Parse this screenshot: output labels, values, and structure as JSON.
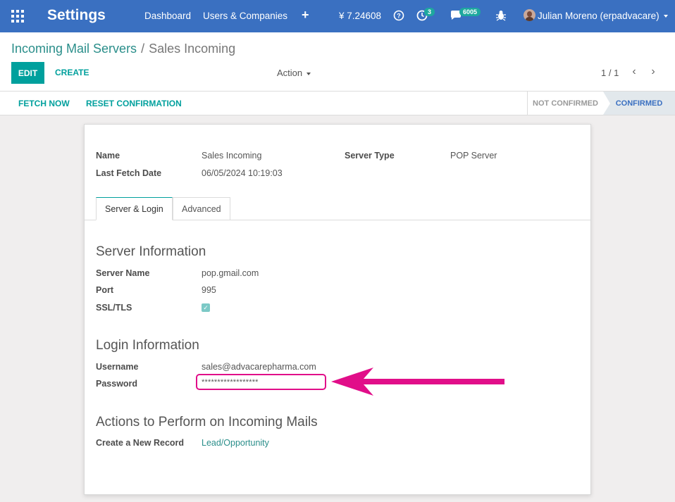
{
  "navbar": {
    "title": "Settings",
    "links": [
      "Dashboard",
      "Users & Companies"
    ],
    "plus_icon": "+",
    "currency": "¥ 7.24608",
    "activity_count": "3",
    "messages_count": "6005",
    "user": "Julian Moreno (erpadvacare)",
    "colors": {
      "bar": "#3a70c1",
      "badge": "#1ea89e"
    }
  },
  "breadcrumb": {
    "parent": "Incoming Mail Servers",
    "separator": "/",
    "current": "Sales Incoming"
  },
  "toolbar": {
    "edit": "EDIT",
    "create": "CREATE",
    "action": "Action",
    "pager": "1 / 1"
  },
  "statusbar": {
    "fetch_now": "FETCH NOW",
    "reset": "RESET CONFIRMATION",
    "stages": [
      "NOT CONFIRMED",
      "CONFIRMED"
    ],
    "active_stage": "CONFIRMED"
  },
  "form": {
    "name_label": "Name",
    "name_value": "Sales Incoming",
    "last_fetch_label": "Last Fetch Date",
    "last_fetch_value": "06/05/2024 10:19:03",
    "server_type_label": "Server Type",
    "server_type_value": "POP Server",
    "tabs": [
      "Server & Login",
      "Advanced"
    ],
    "server_info_title": "Server Information",
    "server_name_label": "Server Name",
    "server_name_value": "pop.gmail.com",
    "port_label": "Port",
    "port_value": "995",
    "ssl_label": "SSL/TLS",
    "ssl_checked": true,
    "login_info_title": "Login Information",
    "username_label": "Username",
    "username_value": "sales@advacarepharma.com",
    "password_label": "Password",
    "password_value": "******************",
    "actions_title": "Actions to Perform on Incoming Mails",
    "create_record_label": "Create a New Record",
    "create_record_value": "Lead/Opportunity"
  },
  "annotation": {
    "color": "#e10e89"
  }
}
